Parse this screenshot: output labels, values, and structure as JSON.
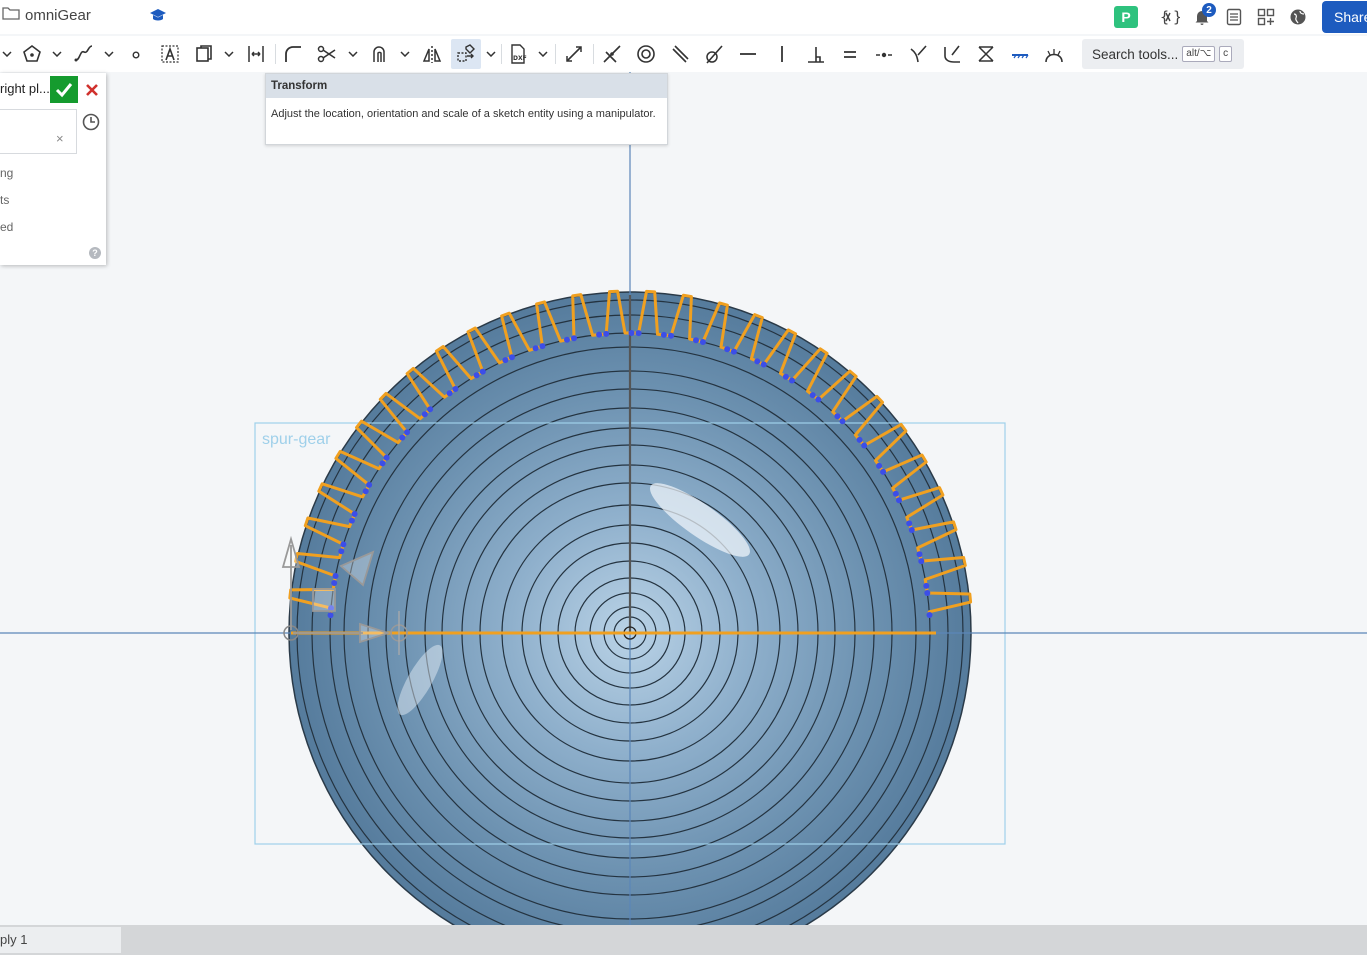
{
  "document": {
    "title": "omniGear"
  },
  "header": {
    "badge_letter": "P",
    "notification_count": "2",
    "share_label": "Share"
  },
  "toolbar": {
    "search_label": "Search tools...",
    "search_shortcut_1": "alt/⌥",
    "search_shortcut_2": "c",
    "active_tool": "transform"
  },
  "tooltip": {
    "title": "Transform",
    "description": "Adjust the location, orientation and scale of a sketch entity using a manipulator."
  },
  "panel": {
    "title": "right pl...",
    "options": [
      "ng",
      "ts",
      "ed"
    ]
  },
  "viewport": {
    "sketch_label": "spur-gear"
  },
  "bottom_tabs": [
    "ply 1"
  ],
  "colors": {
    "accent": "#1d5bbf",
    "sketch": "#f0a020",
    "ok": "#159b2e",
    "gear": "#6b93b0"
  }
}
